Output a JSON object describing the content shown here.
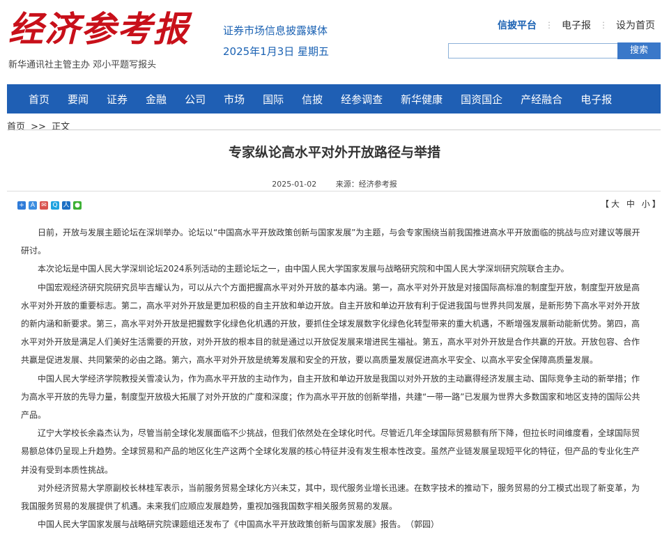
{
  "header": {
    "logo_text": "经济参考报",
    "logo_sub": "新华通讯社主管主办  邓小平题写报头",
    "slogan": "证券市场信息披露媒体",
    "date": "2025年1月3日 星期五",
    "toplinks": [
      "信披平台",
      "电子报",
      "设为首页"
    ],
    "search_button": "搜索",
    "search_value": ""
  },
  "nav": [
    "首页",
    "要闻",
    "证券",
    "金融",
    "公司",
    "市场",
    "国际",
    "信披",
    "经参调查",
    "新华健康",
    "国资国企",
    "产经融合",
    "电子报"
  ],
  "breadcrumb": {
    "home": "首页",
    "sep": ">>",
    "current": "正文"
  },
  "article": {
    "title": "专家纵论高水平对外开放路径与举措",
    "date": "2025-01-02",
    "source": "来源：经济参考报",
    "fontsize_label": "【大 中 小】",
    "share_icons": [
      "share-plus",
      "share-a",
      "share-mail",
      "share-q",
      "share-renren",
      "share-wechat"
    ],
    "paragraphs": [
      "日前，开放与发展主题论坛在深圳举办。论坛以“中国高水平开放政策创新与国家发展”为主题，与会专家围绕当前我国推进高水平开放面临的挑战与应对建议等展开研讨。",
      "本次论坛是中国人民大学深圳论坛2024系列活动的主题论坛之一，由中国人民大学国家发展与战略研究院和中国人民大学深圳研究院联合主办。",
      "中国宏观经济研究院研究员毕吉耀认为，可以从六个方面把握高水平对外开放的基本内涵。第一，高水平对外开放是对接国际高标准的制度型开放，制度型开放是高水平对外开放的重要标志。第二，高水平对外开放是更加积极的自主开放和单边开放。自主开放和单边开放有利于促进我国与世界共同发展，是新形势下高水平对外开放的新内涵和新要求。第三，高水平对外开放是把握数字化绿色化机遇的开放，要抓住全球发展数字化绿色化转型带来的重大机遇，不断增强发展新动能新优势。第四，高水平对外开放是满足人们美好生活需要的开放，对外开放的根本目的就是通过以开放促发展来增进民生福祉。第五，高水平对外开放是合作共赢的开放。开放包容、合作共赢是促进发展、共同繁荣的必由之路。第六，高水平对外开放是统筹发展和安全的开放，要以高质量发展促进高水平安全、以高水平安全保障高质量发展。",
      "中国人民大学经济学院教授关雪凌认为，作为高水平开放的主动作为，自主开放和单边开放是我国以对外开放的主动赢得经济发展主动、国际竞争主动的新举措；作为高水平开放的先导力量，制度型开放极大拓展了对外开放的广度和深度；作为高水平开放的创新举措，共建“一带一路”已发展为世界大多数国家和地区支持的国际公共产品。",
      "辽宁大学校长余淼杰认为，尽管当前全球化发展面临不少挑战，但我们依然处在全球化时代。尽管近几年全球国际贸易额有所下降，但拉长时间维度看，全球国际贸易额总体仍呈现上升趋势。全球贸易和产品的地区化生产这两个全球化发展的核心特征并没有发生根本性改变。虽然产业链发展呈现短平化的特征，但产品的专业化生产并没有受到本质性挑战。",
      "对外经济贸易大学原副校长林桂军表示，当前服务贸易全球化方兴未艾，其中，现代服务业增长迅速。在数字技术的推动下，服务贸易的分工模式出现了新变革，为我国服务贸易的发展提供了机遇。未来我们应顺应发展趋势，重视加强我国数字相关服务贸易的发展。",
      "中国人民大学国家发展与战略研究院课题组还发布了《中国高水平开放政策创新与国家发展》报告。　（郭园）"
    ]
  },
  "colors": {
    "brand_red": "#c8101a",
    "nav_blue": "#1f5fb4",
    "link_blue": "#1b62b3"
  }
}
